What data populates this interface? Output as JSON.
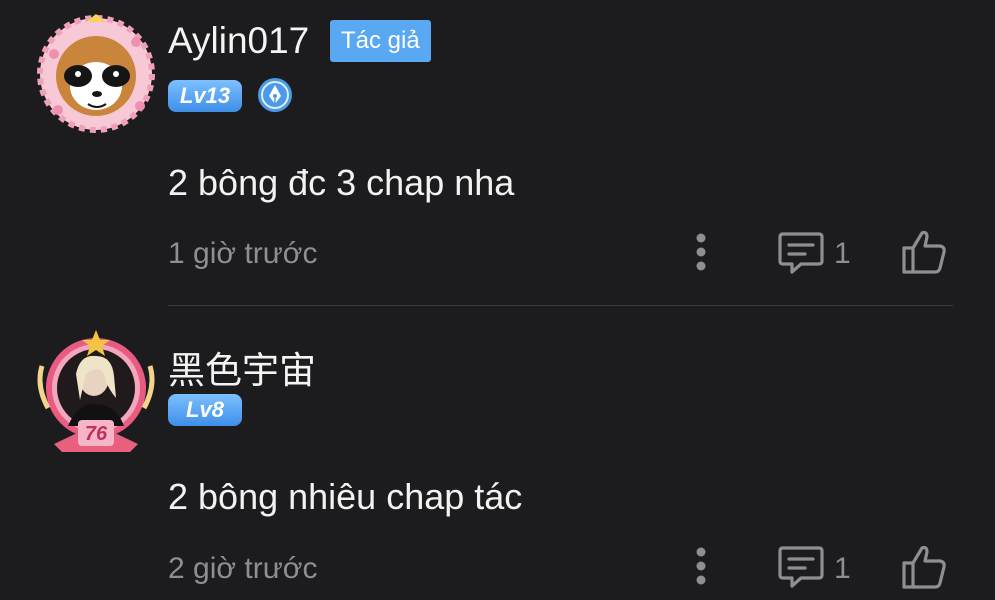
{
  "comments": [
    {
      "username": "Aylin017",
      "author_badge": "Tác giả",
      "level": "Lv13",
      "badge_icon": "pen-nib-icon",
      "text": "2 bông đc 3 chap nha",
      "time": "1 giờ trước",
      "reply_count": "1"
    },
    {
      "username": "黑色宇宙",
      "level": "Lv8",
      "frame_number": "76",
      "text": "2 bông nhiêu chap tác",
      "time": "2 giờ trước",
      "reply_count": "1"
    }
  ],
  "colors": {
    "background": "#1c1c1e",
    "accent": "#5aa7f2",
    "muted": "#8e8e93",
    "divider": "#3a3a3d"
  },
  "icons": [
    "more-vertical-icon",
    "reply-comment-icon",
    "thumbs-up-icon"
  ]
}
